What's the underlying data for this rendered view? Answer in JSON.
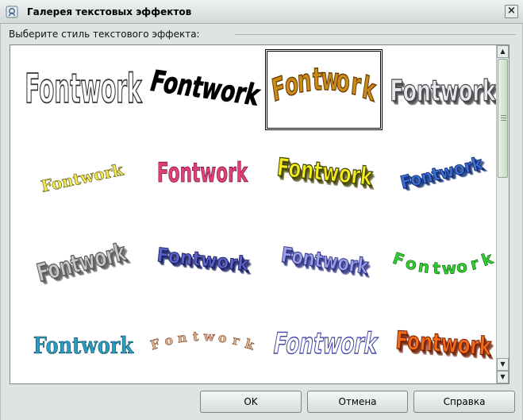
{
  "window": {
    "title": "Галерея текстовых эффектов",
    "close_glyph": "×"
  },
  "section": {
    "label": "Выберите стиль текстового эффекта:"
  },
  "gallery": {
    "selected_index": 2,
    "items": [
      {
        "text": "Fontwork",
        "style": "outline-tall",
        "fill": "#ffffff",
        "stroke": "#333333"
      },
      {
        "text": "Fontwork",
        "style": "black-slant",
        "fill": "#000000",
        "stroke": "#000000"
      },
      {
        "text": "Fontwork",
        "style": "gold-arch",
        "fill": "#c98a1a",
        "stroke": "#6b3d00"
      },
      {
        "text": "Fontwork",
        "style": "gray-3d",
        "fill": "#e8e8f0",
        "stroke": "#444444"
      },
      {
        "text": "Fontwork",
        "style": "yellow-serif",
        "fill": "#f3e94a",
        "stroke": "#3a3300"
      },
      {
        "text": "Fontwork",
        "style": "pink-perspective",
        "fill": "#e0407a",
        "stroke": "#6a1035"
      },
      {
        "text": "Fontwork",
        "style": "yellow-3d",
        "fill": "#f4ee1e",
        "stroke": "#404000"
      },
      {
        "text": "Fontwork",
        "style": "blue-3d",
        "fill": "#3f6fd8",
        "stroke": "#0b2a70"
      },
      {
        "text": "Fontwork",
        "style": "silver-3d",
        "fill": "#c8c8c8",
        "stroke": "#555555"
      },
      {
        "text": "Fontwork",
        "style": "navy-3d",
        "fill": "#5b62c8",
        "stroke": "#151a60"
      },
      {
        "text": "Fontwork",
        "style": "purple-chrome",
        "fill": "#9da0e8",
        "stroke": "#2b2e80"
      },
      {
        "text": "Fontwork",
        "style": "green-circle",
        "fill": "#2fd12f",
        "stroke": "#0c5a0c"
      },
      {
        "text": "Fontwork",
        "style": "teal-serif",
        "fill": "#2a9cc0",
        "stroke": "#0a3f55"
      },
      {
        "text": "Fontwork",
        "style": "brown-arch",
        "fill": "#e0b08a",
        "stroke": "#6b3d20"
      },
      {
        "text": "Fontwork",
        "style": "outline-wave",
        "fill": "#ffffff",
        "stroke": "#4444aa"
      },
      {
        "text": "Fontwork",
        "style": "fire-3d",
        "fill": "#f06a1a",
        "stroke": "#6e1a00"
      }
    ]
  },
  "buttons": {
    "ok": "OK",
    "cancel": "Отмена",
    "help": "Справка"
  }
}
